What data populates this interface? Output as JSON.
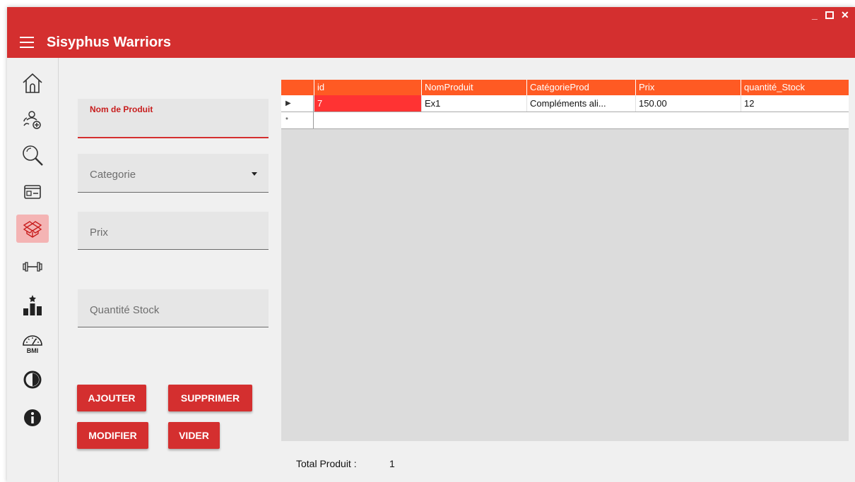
{
  "app": {
    "title": "Sisyphus Warriors",
    "minimize": "_",
    "maximize": "☐",
    "close": "✕"
  },
  "sidebar": {
    "items": [
      {
        "name": "home-icon",
        "active": false
      },
      {
        "name": "add-members-icon",
        "active": false
      },
      {
        "name": "search-icon",
        "active": false
      },
      {
        "name": "card-icon",
        "active": false
      },
      {
        "name": "products-box-icon",
        "active": true
      },
      {
        "name": "dumbbell-icon",
        "active": false
      },
      {
        "name": "ranking-icon",
        "active": false
      },
      {
        "name": "bmi-icon",
        "active": false
      },
      {
        "name": "contrast-icon",
        "active": false
      },
      {
        "name": "info-icon",
        "active": false
      }
    ],
    "bmi_text": "BMI"
  },
  "form": {
    "nom_label": "Nom de Produit",
    "nom_value": "",
    "categorie_label": "Categorie",
    "prix_label": "Prix",
    "quantite_label": "Quantité  Stock"
  },
  "buttons": {
    "ajouter": "AJOUTER",
    "supprimer": "SUPPRIMER",
    "modifier": "MODIFIER",
    "vider": "VIDER"
  },
  "table": {
    "columns": [
      "id",
      "NomProduit",
      "CatégorieProd",
      "Prix",
      "quantité_Stock"
    ],
    "rows": [
      [
        "7",
        "Ex1",
        "Compléments ali...",
        "150.00",
        "12"
      ]
    ],
    "current_row_marker": "▶",
    "new_row_marker": "*"
  },
  "footer": {
    "total_label": "Total Produit :",
    "total_value": "1"
  },
  "colors": {
    "primary": "#d42f2f",
    "header": "#ff5a23",
    "selected_cell": "#ff3333"
  }
}
